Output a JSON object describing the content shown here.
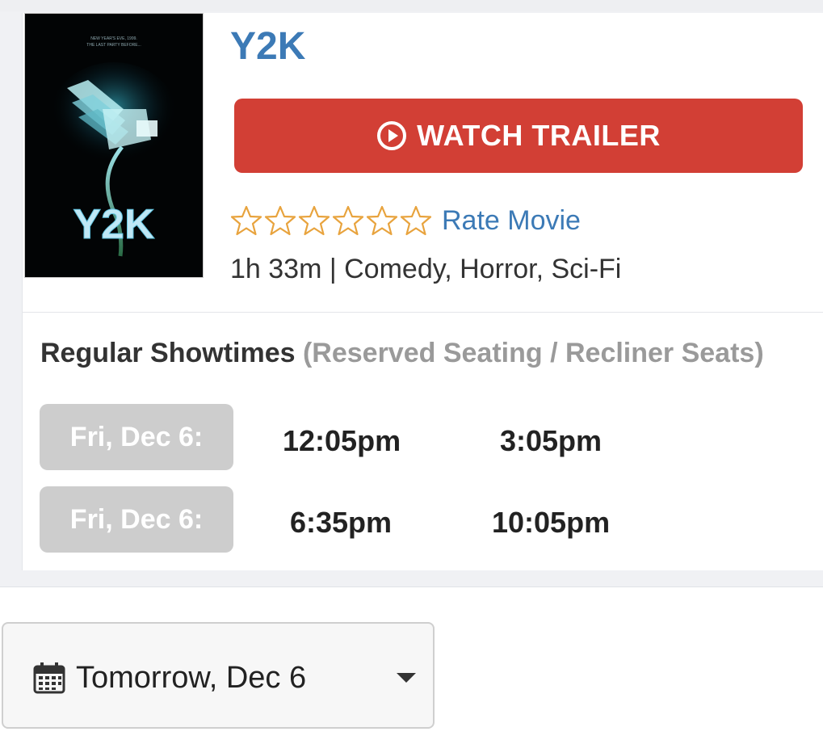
{
  "movie": {
    "title": "Y2K",
    "poster_alt": "Y2K movie poster",
    "poster": {
      "tagline_line1": "NEW YEAR'S EVE, 1999.",
      "tagline_line2": "THE LAST PARTY BEFORE...",
      "title_text": "Y2K"
    },
    "trailer_label": "WATCH TRAILER",
    "rate_label": "Rate Movie",
    "rating_stars": 6,
    "meta": "1h 33m | Comedy, Horror, Sci-Fi"
  },
  "showtimes": {
    "heading": "Regular Showtimes",
    "subheading": "(Reserved Seating / Recliner Seats)",
    "rows": [
      {
        "date": "Fri, Dec 6:",
        "times": [
          "12:05pm",
          "3:05pm"
        ]
      },
      {
        "date": "Fri, Dec 6:",
        "times": [
          "6:35pm",
          "10:05pm"
        ]
      }
    ]
  },
  "date_select": {
    "value": "Tomorrow, Dec 6"
  },
  "colors": {
    "title_blue": "#3c7ab6",
    "trailer_red": "#d23f35",
    "star_gold": "#e8a33d",
    "pill_gray": "#cdcdcd"
  },
  "icons": {
    "trailer": "play-circle-icon",
    "star": "star-outline-icon",
    "calendar": "calendar-icon",
    "caret": "caret-down-icon"
  }
}
